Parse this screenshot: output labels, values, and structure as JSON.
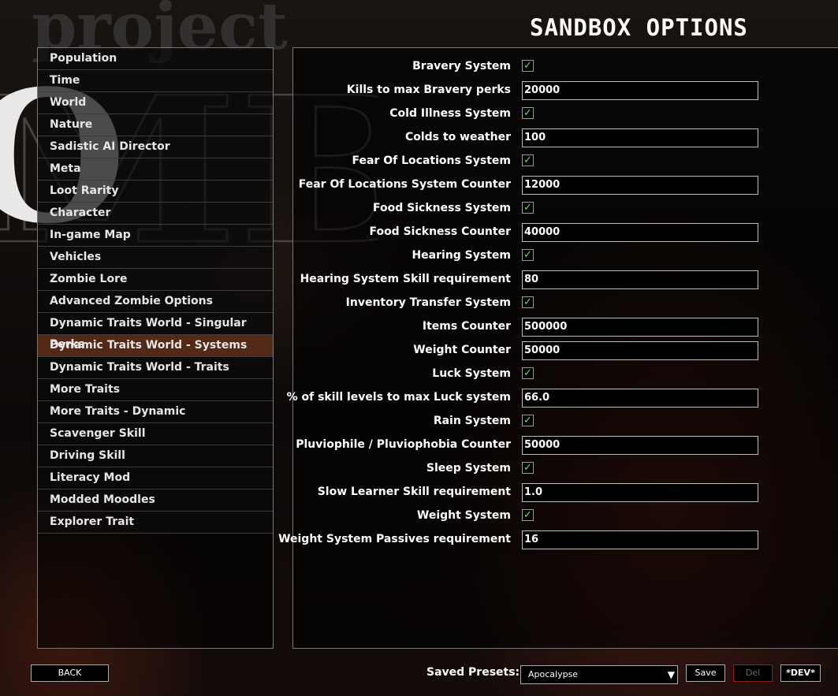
{
  "title": "SANDBOX OPTIONS",
  "logo_text": [
    "project",
    "ZOMBOID"
  ],
  "sidebar": {
    "items": [
      {
        "label": "Population",
        "selected": false
      },
      {
        "label": "Time",
        "selected": false
      },
      {
        "label": "World",
        "selected": false
      },
      {
        "label": "Nature",
        "selected": false
      },
      {
        "label": "Sadistic AI Director",
        "selected": false
      },
      {
        "label": "Meta",
        "selected": false
      },
      {
        "label": "Loot Rarity",
        "selected": false
      },
      {
        "label": "Character",
        "selected": false
      },
      {
        "label": "In-game Map",
        "selected": false
      },
      {
        "label": "Vehicles",
        "selected": false
      },
      {
        "label": "Zombie Lore",
        "selected": false
      },
      {
        "label": "Advanced Zombie Options",
        "selected": false
      },
      {
        "label": "Dynamic Traits World - Singular Perks",
        "selected": false
      },
      {
        "label": "Dynamic Traits World - Systems",
        "selected": true
      },
      {
        "label": "Dynamic Traits World - Traits",
        "selected": false
      },
      {
        "label": "More Traits",
        "selected": false
      },
      {
        "label": "More Traits - Dynamic",
        "selected": false
      },
      {
        "label": "Scavenger Skill",
        "selected": false
      },
      {
        "label": "Driving Skill",
        "selected": false
      },
      {
        "label": "Literacy Mod",
        "selected": false
      },
      {
        "label": "Modded Moodles",
        "selected": false
      },
      {
        "label": "Explorer Trait",
        "selected": false
      }
    ]
  },
  "options": [
    {
      "label": "Bravery System",
      "type": "checkbox",
      "checked": true
    },
    {
      "label": "Kills to max Bravery perks",
      "type": "text",
      "value": "20000"
    },
    {
      "label": "Cold Illness System",
      "type": "checkbox",
      "checked": true
    },
    {
      "label": "Colds to weather",
      "type": "text",
      "value": "100"
    },
    {
      "label": "Fear Of Locations System",
      "type": "checkbox",
      "checked": true
    },
    {
      "label": "Fear Of Locations System Counter",
      "type": "text",
      "value": "12000"
    },
    {
      "label": "Food Sickness System",
      "type": "checkbox",
      "checked": true
    },
    {
      "label": "Food Sickness Counter",
      "type": "text",
      "value": "40000"
    },
    {
      "label": "Hearing System",
      "type": "checkbox",
      "checked": true
    },
    {
      "label": "Hearing System Skill requirement",
      "type": "text",
      "value": "80"
    },
    {
      "label": "Inventory Transfer System",
      "type": "checkbox",
      "checked": true
    },
    {
      "label": "Items Counter",
      "type": "text",
      "value": "500000"
    },
    {
      "label": "Weight Counter",
      "type": "text",
      "value": "50000"
    },
    {
      "label": "Luck System",
      "type": "checkbox",
      "checked": true
    },
    {
      "label": "% of skill levels to max Luck system",
      "type": "text",
      "value": "66.0"
    },
    {
      "label": "Rain System",
      "type": "checkbox",
      "checked": true
    },
    {
      "label": "Pluviophile / Pluviophobia Counter",
      "type": "text",
      "value": "50000"
    },
    {
      "label": "Sleep System",
      "type": "checkbox",
      "checked": true
    },
    {
      "label": "Slow Learner Skill requirement",
      "type": "text",
      "value": "1.0"
    },
    {
      "label": "Weight System",
      "type": "checkbox",
      "checked": true
    },
    {
      "label": "Weight System Passives requirement",
      "type": "text",
      "value": "16"
    }
  ],
  "check_mark": "✓",
  "footer": {
    "back_label": "BACK",
    "presets_label": "Saved Presets:",
    "preset_value": "Apocalypse",
    "dropdown_arrow": "▼",
    "save_label": "Save",
    "del_label": "Del",
    "dev_label": "*DEV*"
  },
  "colors": {
    "selected_item": "#60301c",
    "check": "#5fe35f",
    "del_border": "#8a2020"
  }
}
